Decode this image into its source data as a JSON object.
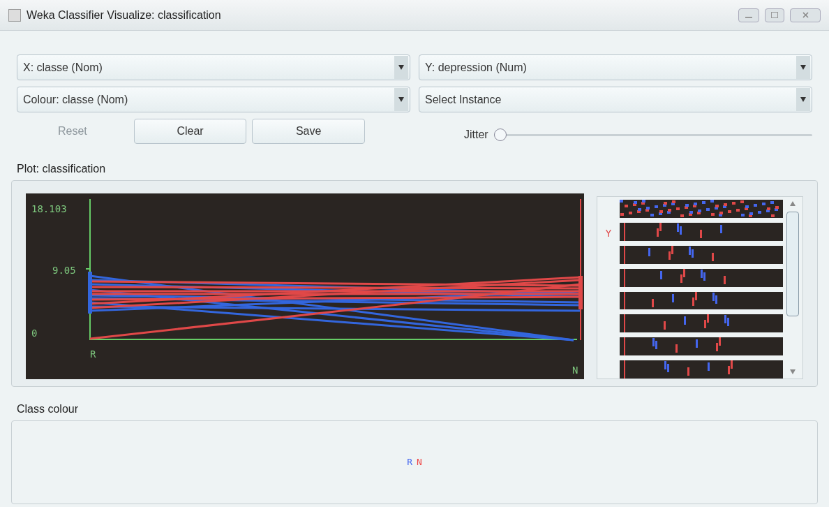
{
  "window": {
    "title": "Weka Classifier Visualize: classification"
  },
  "selectors": [
    {
      "label": "X: classe (Nom)"
    },
    {
      "label": "Y: depression (Num)"
    },
    {
      "label": "Colour: classe (Nom)"
    },
    {
      "label": "Select Instance"
    }
  ],
  "buttons": [
    {
      "label": "Reset",
      "disabled": true
    },
    {
      "label": "Clear",
      "disabled": false
    },
    {
      "label": "Save",
      "disabled": false
    }
  ],
  "jitter": {
    "label": "Jitter",
    "level": 0
  },
  "plot": {
    "title": "Plot: classification",
    "y_ticks": [
      "18.103",
      "9.05",
      "0"
    ],
    "x_labels": [
      "R",
      "N"
    ],
    "strip_label": "Y"
  },
  "class_colour": {
    "title": "Class colour",
    "classes": [
      {
        "name": "R",
        "color": "#4466ee"
      },
      {
        "name": "N",
        "color": "#ee4444"
      }
    ]
  }
}
